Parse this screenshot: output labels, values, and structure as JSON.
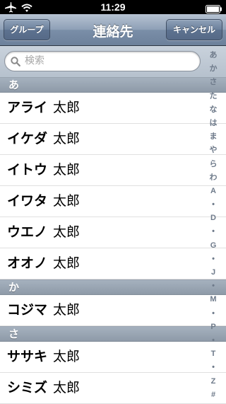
{
  "status_bar": {
    "time": "11:29",
    "icons": [
      "airplane-icon",
      "wifi-icon",
      "battery-icon"
    ]
  },
  "nav_bar": {
    "title": "連絡先",
    "left_button": "グループ",
    "right_button": "キャンセル"
  },
  "search": {
    "placeholder": "検索",
    "value": ""
  },
  "sections": [
    {
      "header": "あ",
      "contacts": [
        {
          "last": "アライ",
          "first": "太郎"
        },
        {
          "last": "イケダ",
          "first": "太郎"
        },
        {
          "last": "イトウ",
          "first": "太郎"
        },
        {
          "last": "イワタ",
          "first": "太郎"
        },
        {
          "last": "ウエノ",
          "first": "太郎"
        },
        {
          "last": "オオノ",
          "first": "太郎"
        }
      ]
    },
    {
      "header": "か",
      "contacts": [
        {
          "last": "コジマ",
          "first": "太郎"
        }
      ]
    },
    {
      "header": "さ",
      "contacts": [
        {
          "last": "ササキ",
          "first": "太郎"
        },
        {
          "last": "シミズ",
          "first": "太郎"
        }
      ]
    }
  ],
  "section_index": [
    "あ",
    "か",
    "さ",
    "た",
    "な",
    "は",
    "ま",
    "や",
    "ら",
    "わ",
    "A",
    "•",
    "D",
    "•",
    "G",
    "•",
    "J",
    "•",
    "M",
    "•",
    "P",
    "•",
    "T",
    "•",
    "Z",
    "#"
  ],
  "colors": {
    "nav_bar": "#8d9fb6",
    "section_header": "#98a4b1",
    "index_text": "#6e7a8a"
  }
}
